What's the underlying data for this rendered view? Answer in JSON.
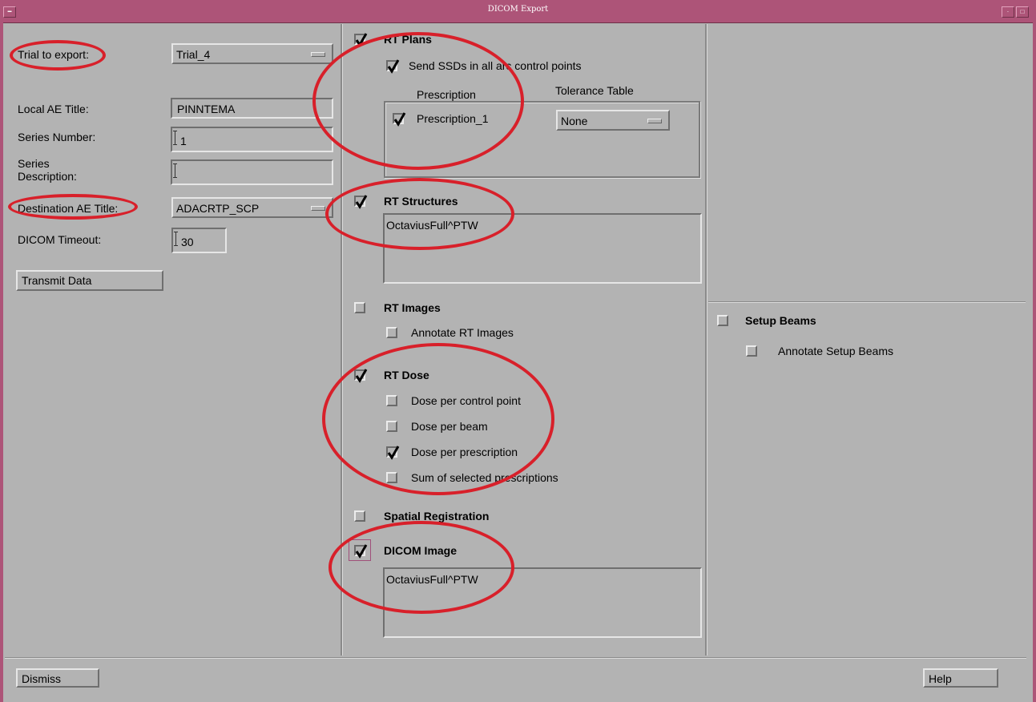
{
  "window": {
    "title": "DICOM Export"
  },
  "left": {
    "trial_label": "Trial to export:",
    "trial_value": "Trial_4",
    "local_ae_label": "Local AE Title:",
    "local_ae_value": "PINNTEMA",
    "series_number_label": "Series Number:",
    "series_number_value": "1",
    "series_desc_label_1": "Series",
    "series_desc_label_2": "Description:",
    "series_desc_value": "",
    "dest_ae_label": "Destination AE Title:",
    "dest_ae_value": "ADACRTP_SCP",
    "timeout_label": "DICOM Timeout:",
    "timeout_value": "30",
    "transmit_label": "Transmit Data"
  },
  "rt_plans": {
    "label": "RT Plans",
    "checked": true,
    "send_ssds_label": "Send SSDs in all arc control points",
    "send_ssds_checked": true,
    "prescription_header": "Prescription",
    "tolerance_header": "Tolerance Table",
    "prescriptions": [
      {
        "name": "Prescription_1",
        "checked": true,
        "tolerance": "None"
      }
    ]
  },
  "rt_structures": {
    "label": "RT Structures",
    "checked": true,
    "items": [
      "OctaviusFull^PTW"
    ]
  },
  "rt_images": {
    "label": "RT Images",
    "checked": false,
    "annotate_label": "Annotate RT Images",
    "annotate_checked": false
  },
  "rt_dose": {
    "label": "RT Dose",
    "checked": true,
    "options": [
      {
        "label": "Dose per control point",
        "checked": false
      },
      {
        "label": "Dose per beam",
        "checked": false
      },
      {
        "label": "Dose per prescription",
        "checked": true
      },
      {
        "label": "Sum of selected prescriptions",
        "checked": false
      }
    ]
  },
  "spatial_registration": {
    "label": "Spatial Registration",
    "checked": false
  },
  "dicom_image": {
    "label": "DICOM Image",
    "checked": true,
    "items": [
      "OctaviusFull^PTW"
    ]
  },
  "setup_beams": {
    "label": "Setup Beams",
    "checked": false,
    "annotate_label": "Annotate Setup Beams",
    "annotate_checked": false
  },
  "footer": {
    "dismiss_label": "Dismiss",
    "help_label": "Help"
  },
  "colors": {
    "background": "#b3b3b3",
    "titlebar": "#ad5478",
    "annotation": "#d8202a"
  }
}
